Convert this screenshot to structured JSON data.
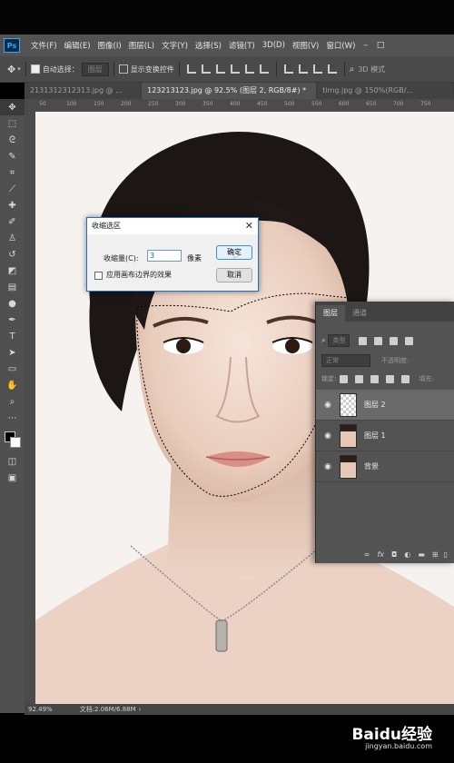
{
  "menubar": {
    "logo": "Ps",
    "items": [
      "文件(F)",
      "编辑(E)",
      "图像(I)",
      "图层(L)",
      "文字(Y)",
      "选择(S)",
      "滤镜(T)",
      "3D(D)",
      "视图(V)",
      "窗口(W)"
    ],
    "win_controls": [
      "–",
      "□"
    ]
  },
  "options": {
    "auto_select_label": "自动选择：",
    "auto_select_target": "图层",
    "show_transform_label": "显示变换控件",
    "mode_3d": "3D 模式"
  },
  "tabs": [
    {
      "label": "2131312312313.jpg @ ..."
    },
    {
      "label": "123213123.jpg @ 92.5% (图层 2, RGB/8#) *"
    },
    {
      "label": "timg.jpg @ 150%(RGB/..."
    }
  ],
  "ruler_ticks": [
    "50",
    "100",
    "150",
    "200",
    "250",
    "300",
    "350",
    "400",
    "450",
    "500",
    "550",
    "600",
    "650",
    "700",
    "750"
  ],
  "dialog": {
    "title": "收缩选区",
    "amount_label": "收缩量(C):",
    "amount_value": "3",
    "unit": "像素",
    "checkbox_label": "应用画布边界的效果",
    "ok_label": "确定",
    "cancel_label": "取消"
  },
  "layers_panel": {
    "tabs": [
      "图层",
      "通道"
    ],
    "search_placeholder": "类型",
    "blend_mode": "正常",
    "opacity_label": "不透明度:",
    "lock_label": "锁定:",
    "fill_label": "填充:",
    "layers": [
      {
        "name": "图层 2",
        "selected": true
      },
      {
        "name": "图层 1",
        "selected": false
      },
      {
        "name": "背景",
        "selected": false
      }
    ],
    "footer_icons": [
      "link-icon",
      "fx-icon",
      "mask-icon",
      "adjustment-icon",
      "folder-icon",
      "new-layer-icon",
      "trash-icon"
    ]
  },
  "status": {
    "zoom": "92.49%",
    "doc_info": "文档:2.06M/6.88M"
  },
  "watermark": {
    "brand": "Baidu经验",
    "url": "jingyan.baidu.com"
  },
  "colors": {
    "ps_bg": "#535353",
    "accent": "#31a8ff"
  }
}
